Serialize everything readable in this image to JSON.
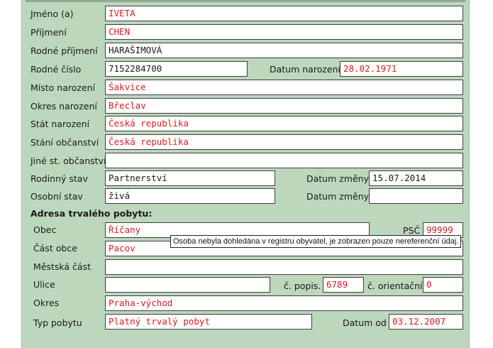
{
  "fields": {
    "jmeno": {
      "label": "Jméno (a)",
      "value": "IVETA"
    },
    "prijmeni": {
      "label": "Příjmení",
      "value": "CHEN"
    },
    "rodne_prijmeni": {
      "label": "Rodné příjmení",
      "value": "HARAŠIMOVÁ"
    },
    "rodne_cislo": {
      "label": "Rodné číslo",
      "value": "7152284700"
    },
    "datum_narozeni": {
      "label": "Datum narození",
      "value": "28.02.1971"
    },
    "misto_narozeni": {
      "label": "Místo narození",
      "value": "Šakvice"
    },
    "okres_narozeni": {
      "label": "Okres narození",
      "value": "Břeclav"
    },
    "stat_narozeni": {
      "label": "Stát narození",
      "value": "Česká republika"
    },
    "stani_obcanstvi": {
      "label": "Stání občanství",
      "value": "Česká republika"
    },
    "jine_obcanstvi": {
      "label": "Jiné st. občanství",
      "value": ""
    },
    "rodinny_stav": {
      "label": "Rodinný stav",
      "value": "Partnerství"
    },
    "datum_zmeny_1": {
      "label": "Datum změny",
      "value": "15.07.2014"
    },
    "osobni_stav": {
      "label": "Osobní stav",
      "value": "živá"
    },
    "datum_zmeny_2": {
      "label": "Datum změny",
      "value": ""
    }
  },
  "address": {
    "heading": "Adresa trvalého pobytu:",
    "obec": {
      "label": "Obec",
      "value": "Říčany"
    },
    "psc": {
      "label": "PSČ",
      "value": "99999"
    },
    "cast_obce": {
      "label": "Část obce",
      "value": "Pacov"
    },
    "mestska_cast": {
      "label": "Městská část",
      "value": ""
    },
    "ulice": {
      "label": "Ulice",
      "value": ""
    },
    "cislo_popisne": {
      "label": "č. popis.",
      "value": "6789"
    },
    "cislo_orientacni": {
      "label": "č. orientační",
      "value": "0"
    },
    "okres": {
      "label": "Okres",
      "value": "Praha-východ"
    },
    "typ_pobytu": {
      "label": "Typ pobytu",
      "value": "Platný trvalý pobyt"
    },
    "datum_od": {
      "label": "Datum od",
      "value": "03.12.2007"
    }
  },
  "tooltip": "Osoba nebyla dohledána v registru obyvatel, je zobrazen pouze nereferenční údaj.",
  "colors": {
    "panel_background": "#bdd7bd",
    "referential_value": "#d42020",
    "plain_value": "#1a1a1a"
  }
}
